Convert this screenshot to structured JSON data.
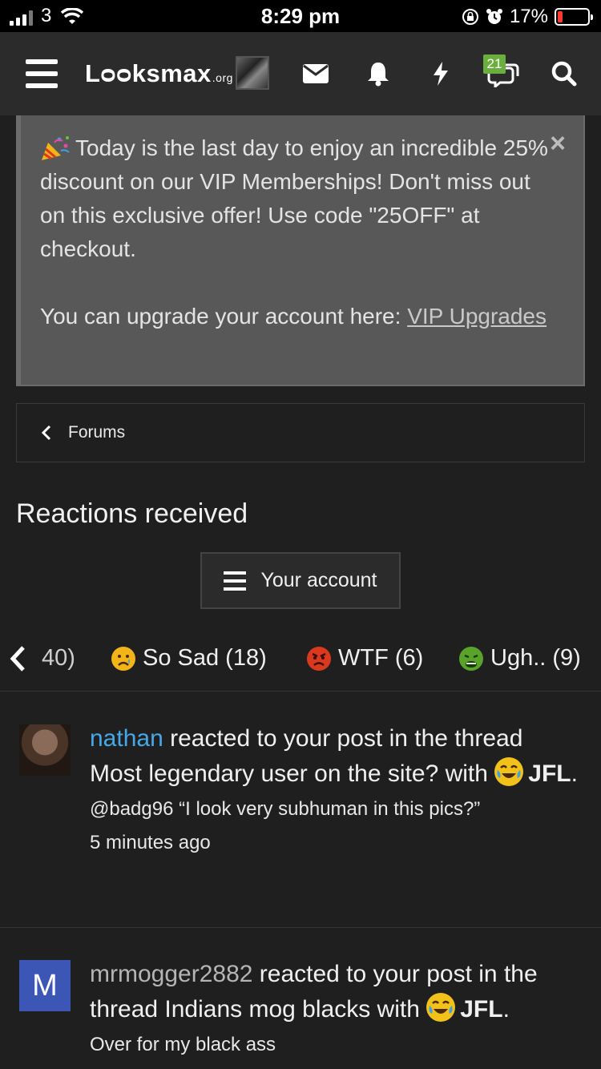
{
  "status_bar": {
    "carrier": "3",
    "time": "8:29 pm",
    "battery": "17%",
    "battery_level": 0.17
  },
  "navbar": {
    "logo_main": "Lᴑᴑksmax",
    "logo_suffix": ".org",
    "badge_count": "21",
    "icons": [
      "menu-icon",
      "avatar",
      "envelope-icon",
      "bell-icon",
      "lightning-icon",
      "chat-icon",
      "search-icon"
    ]
  },
  "notice": {
    "text": "Today is the last day to enjoy an incredible 25% discount on our VIP Memberships! Don't miss out on this exclusive offer! Use code \"25OFF\" at checkout.",
    "upgrade_text": "You can upgrade your account here: ",
    "link_text": "VIP Upgrades",
    "close_label": "×"
  },
  "breadcrumb": {
    "label": "Forums"
  },
  "page": {
    "title": "Reactions received"
  },
  "account_button": {
    "label": "Your account"
  },
  "tabs": [
    {
      "label": "40)",
      "emoji": "none"
    },
    {
      "label": "So Sad (18)",
      "emoji": "sad",
      "color": "#f2b418"
    },
    {
      "label": "WTF (6)",
      "emoji": "angry",
      "color": "#d93a1e"
    },
    {
      "label": "Ugh.. (9)",
      "emoji": "sick",
      "color": "#5aa32b"
    }
  ],
  "feed": [
    {
      "user": "nathan",
      "text1": " reacted to your post in the thread Most legendary user on the site? with ",
      "reaction": "JFL",
      "snippet": "@badg96 “I look very subhuman in this pics?”",
      "time": "5 minutes ago"
    },
    {
      "avatar_letter": "M",
      "user": "mrmogger2882",
      "text1": " reacted to your post in the thread Indians mog blacks with ",
      "reaction": "JFL",
      "snippet": "Over for my black ass"
    }
  ]
}
